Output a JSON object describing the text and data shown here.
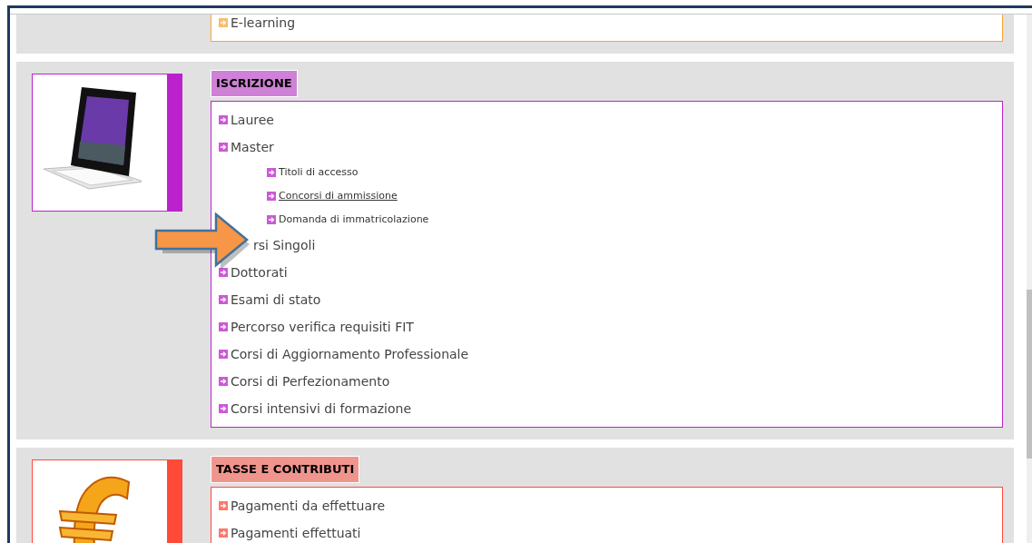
{
  "sections": [
    {
      "color": "#f7a738",
      "kind": "textonly",
      "items": [
        {
          "label": "E-learning",
          "covered": false,
          "hovered": false
        }
      ]
    },
    {
      "color": "#bb22cc",
      "kind": "tablet",
      "heading": "ISCRIZIONE",
      "items": [
        {
          "label": "Lauree",
          "covered": false,
          "hovered": false
        },
        {
          "label": "Master",
          "covered": false,
          "hovered": false,
          "children": [
            {
              "label": "Titoli di accesso",
              "hovered": false
            },
            {
              "label": "Concorsi di ammissione",
              "hovered": true
            },
            {
              "label": "Domanda di immatricolazione",
              "hovered": false
            }
          ]
        },
        {
          "label": "rsi Singoli",
          "covered": true,
          "hovered": false
        },
        {
          "label": "Dottorati",
          "covered": false,
          "hovered": false
        },
        {
          "label": "Esami di stato",
          "covered": false,
          "hovered": false
        },
        {
          "label": "Percorso verifica requisiti FIT",
          "covered": false,
          "hovered": false
        },
        {
          "label": "Corsi di Aggiornamento Professionale",
          "covered": false,
          "hovered": false
        },
        {
          "label": "Corsi di Perfezionamento",
          "covered": false,
          "hovered": false
        },
        {
          "label": "Corsi intensivi di formazione",
          "covered": false,
          "hovered": false
        }
      ]
    },
    {
      "color": "#ff4a3a",
      "kind": "euro",
      "heading": "TASSE E CONTRIBUTI",
      "items": [
        {
          "label": "Pagamenti da effettuare",
          "covered": false,
          "hovered": false
        },
        {
          "label": "Pagamenti effettuati",
          "covered": false,
          "hovered": false
        }
      ]
    }
  ]
}
